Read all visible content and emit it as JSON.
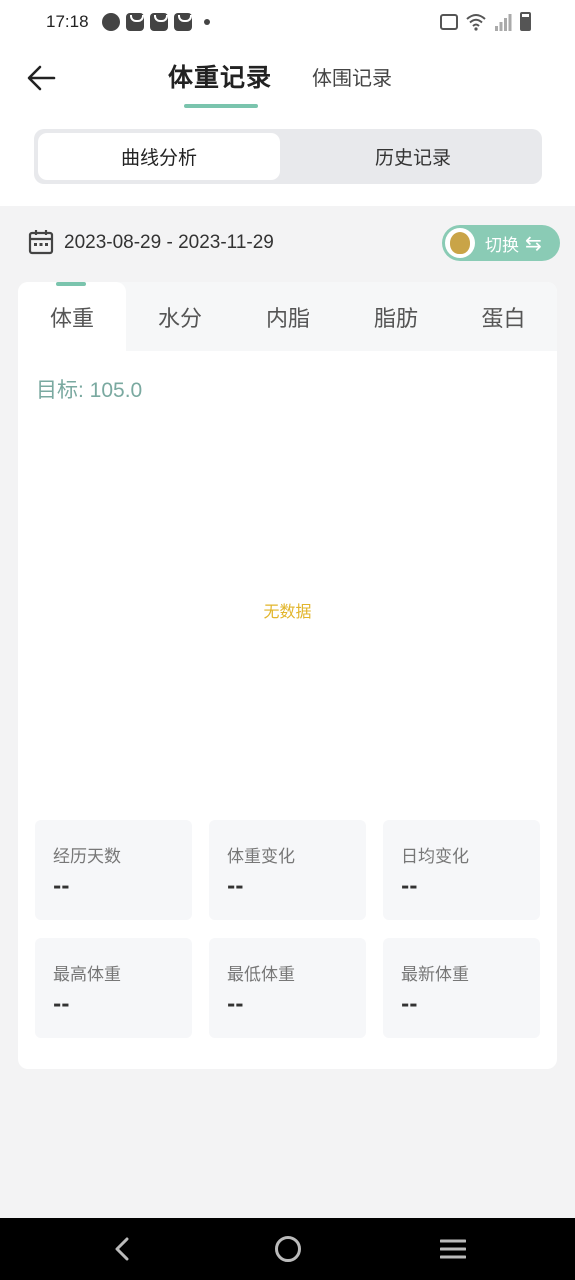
{
  "status_bar": {
    "time": "17:18",
    "left_icons": [
      "speed-icon",
      "bag-icon",
      "bag-icon",
      "bag-icon",
      "dot-icon"
    ],
    "right_icons": [
      "vibrate-icon",
      "wifi-icon",
      "signal-icon",
      "battery-icon"
    ]
  },
  "header": {
    "tabs": [
      {
        "label": "体重记录",
        "active": true
      },
      {
        "label": "体围记录",
        "active": false
      }
    ],
    "segments": [
      {
        "label": "曲线分析",
        "active": true
      },
      {
        "label": "历史记录",
        "active": false
      }
    ]
  },
  "date_row": {
    "range": "2023-08-29 - 2023-11-29",
    "switch_label": "切换",
    "switch_arrows": "⇆"
  },
  "metric_tabs": [
    {
      "label": "体重",
      "active": true
    },
    {
      "label": "水分",
      "active": false
    },
    {
      "label": "内脂",
      "active": false
    },
    {
      "label": "脂肪",
      "active": false
    },
    {
      "label": "蛋白",
      "active": false
    }
  ],
  "chart": {
    "goal": "目标: 105.0",
    "empty_text": "无数据"
  },
  "stats": [
    {
      "label": "经历天数",
      "value": "--"
    },
    {
      "label": "体重变化",
      "value": "--"
    },
    {
      "label": "日均变化",
      "value": "--"
    },
    {
      "label": "最高体重",
      "value": "--"
    },
    {
      "label": "最低体重",
      "value": "--"
    },
    {
      "label": "最新体重",
      "value": "--"
    }
  ],
  "colors": {
    "accent": "#7ac4ad",
    "switch_bg": "#8acbb5",
    "goal_text": "#7aa9a0",
    "empty_text": "#e2b52b"
  }
}
